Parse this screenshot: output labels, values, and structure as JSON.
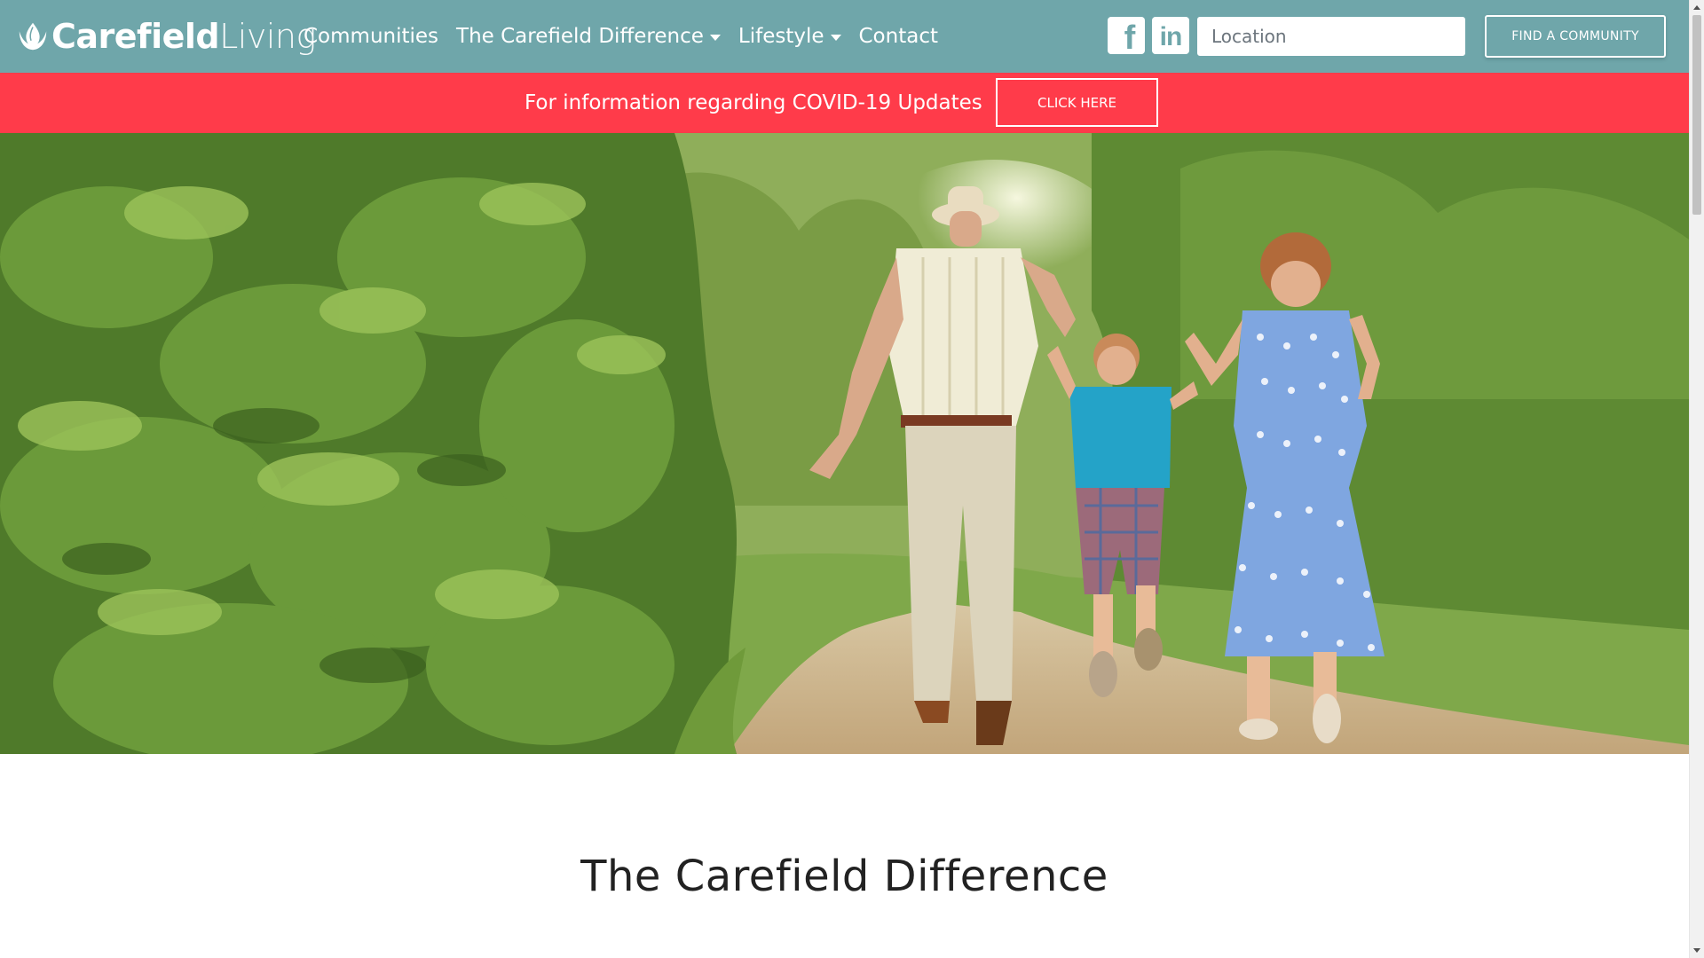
{
  "brand": {
    "name_bold": "Carefield",
    "name_light": "Living",
    "color_primary": "#6fa6aa",
    "color_alert": "#ff3b4a"
  },
  "nav": {
    "items": [
      {
        "label": "Communities",
        "dropdown": false
      },
      {
        "label": "The Carefield Difference",
        "dropdown": true
      },
      {
        "label": "Lifestyle",
        "dropdown": true
      },
      {
        "label": "Contact",
        "dropdown": false
      }
    ],
    "social": [
      {
        "name": "facebook-icon",
        "glyph": "f"
      },
      {
        "name": "linkedin-icon",
        "glyph": "in"
      }
    ],
    "search": {
      "placeholder": "Location",
      "value": ""
    },
    "find_button_label": "FIND A COMMUNITY"
  },
  "alert": {
    "text": "For information regarding COVID-19 Updates",
    "button_label": "CLICK HERE"
  },
  "hero": {
    "image_name": "grandparents-and-child-walking-on-path-photo"
  },
  "section": {
    "title": "The Carefield Difference"
  }
}
